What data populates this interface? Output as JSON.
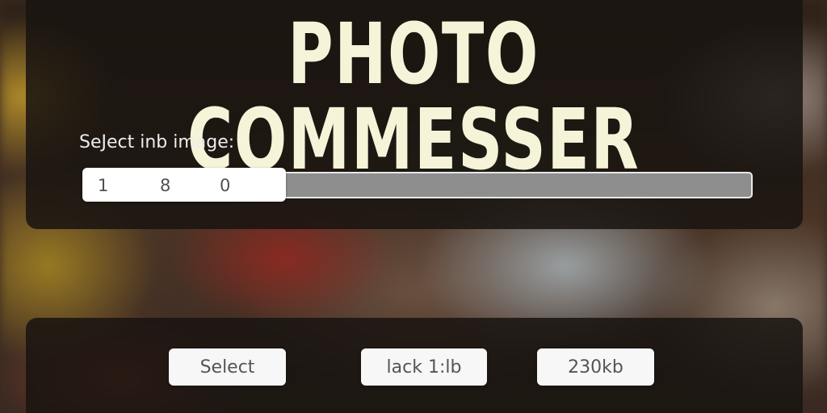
{
  "app": {
    "title": "PHOTO COMMESSER"
  },
  "select": {
    "label": "SeJect inb image:"
  },
  "slider": {
    "ticks": [
      "1",
      "8",
      "0"
    ],
    "value_fraction": 0.3,
    "fill_color": "#ffffff",
    "track_color": "#8e8e8e"
  },
  "actions": {
    "select_label": "Select",
    "ratio_label": "lack 1:lb",
    "size_label": "230kb"
  },
  "colors": {
    "title": "#f6f4d8",
    "panel": "#181410"
  }
}
